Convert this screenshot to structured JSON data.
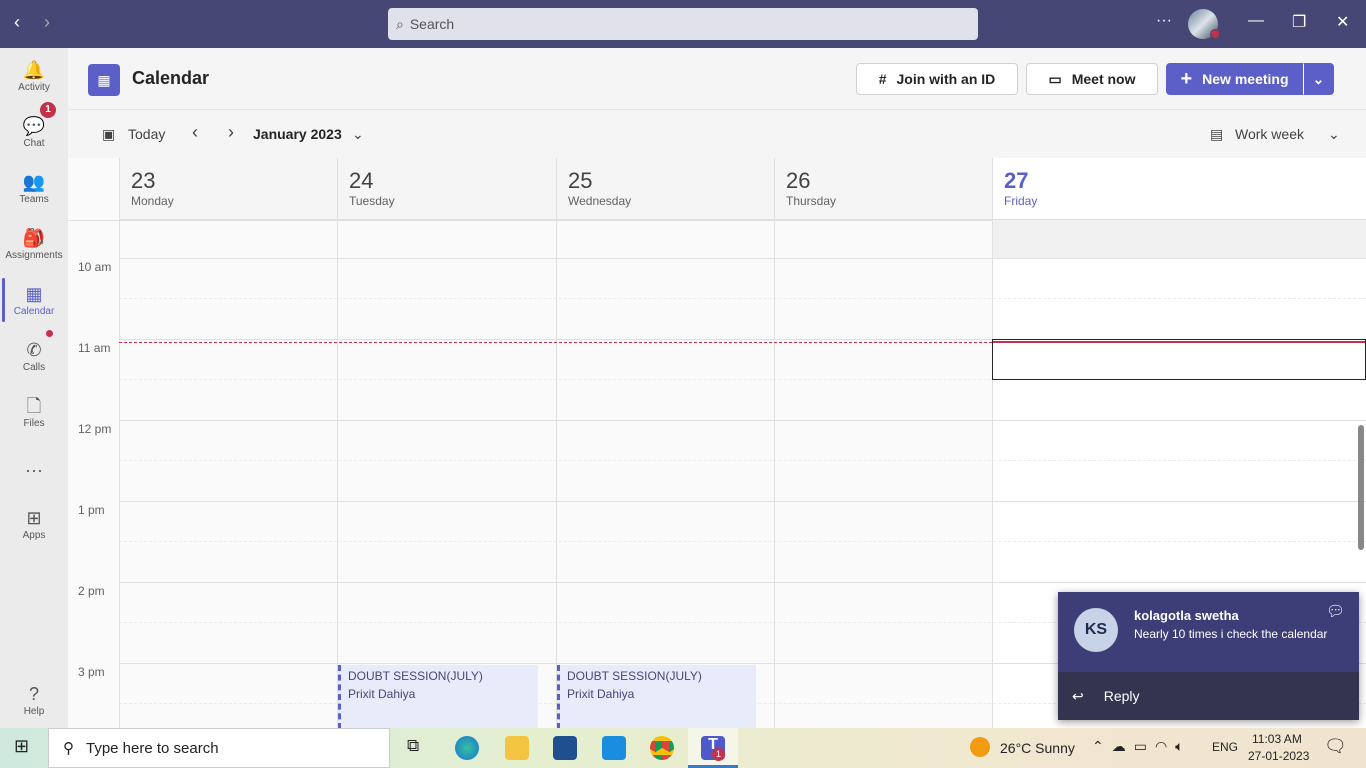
{
  "topbar": {
    "search_placeholder": "Search",
    "more": "···"
  },
  "sidebar": [
    {
      "label": "Activity",
      "icon": "bell-icon",
      "glyph": "🔔"
    },
    {
      "label": "Chat",
      "icon": "chat-icon",
      "glyph": "💬",
      "badge": "1"
    },
    {
      "label": "Teams",
      "icon": "teams-icon",
      "glyph": "👥"
    },
    {
      "label": "Assignments",
      "icon": "backpack-icon",
      "glyph": "🎒"
    },
    {
      "label": "Calendar",
      "icon": "calendar-icon",
      "glyph": "▦",
      "active": true
    },
    {
      "label": "Calls",
      "icon": "phone-icon",
      "glyph": "✆",
      "dot": true
    },
    {
      "label": "Files",
      "icon": "file-icon",
      "glyph": "🗋"
    },
    {
      "label": "",
      "icon": "more-icon",
      "glyph": "···"
    },
    {
      "label": "Apps",
      "icon": "apps-icon",
      "glyph": "⊞"
    },
    {
      "label": "Help",
      "icon": "help-icon",
      "glyph": "?"
    }
  ],
  "header": {
    "title": "Calendar",
    "join": "Join with an ID",
    "meet": "Meet now",
    "new_meeting": "New meeting"
  },
  "toolbar": {
    "today": "Today",
    "month": "January 2023",
    "view": "Work week"
  },
  "days": [
    {
      "num": "23",
      "name": "Monday"
    },
    {
      "num": "24",
      "name": "Tuesday"
    },
    {
      "num": "25",
      "name": "Wednesday"
    },
    {
      "num": "26",
      "name": "Thursday"
    },
    {
      "num": "27",
      "name": "Friday",
      "today": true
    }
  ],
  "times": [
    "10 am",
    "11 am",
    "12 pm",
    "1 pm",
    "2 pm",
    "3 pm"
  ],
  "events": [
    {
      "day": 1,
      "title": "DOUBT SESSION(JULY)",
      "organizer": "Prixit Dahiya"
    },
    {
      "day": 2,
      "title": "DOUBT SESSION(JULY)",
      "organizer": "Prixit Dahiya"
    }
  ],
  "toast": {
    "initials": "KS",
    "name": "kolagotla swetha",
    "message": "Nearly 10 times i check the calendar",
    "reply": "Reply"
  },
  "taskbar": {
    "search": "Type here to search",
    "weather": "26°C  Sunny",
    "lang": "ENG",
    "time": "11:03 AM",
    "date": "27-01-2023",
    "teams_badge": "1"
  }
}
